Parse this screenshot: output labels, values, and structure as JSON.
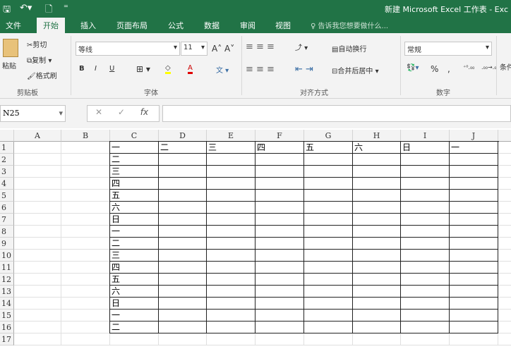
{
  "window": {
    "title": "新建 Microsoft Excel 工作表 - Exc"
  },
  "quick_access": {
    "save": "🖫",
    "undo": "↶▾",
    "new": "🗋",
    "more": "⁼"
  },
  "tabs": [
    {
      "label": "文件"
    },
    {
      "label": "开始",
      "active": true
    },
    {
      "label": "插入"
    },
    {
      "label": "页面布局"
    },
    {
      "label": "公式"
    },
    {
      "label": "数据"
    },
    {
      "label": "审阅"
    },
    {
      "label": "视图"
    }
  ],
  "tell_me": "告诉我您想要做什么...",
  "clipboard": {
    "paste": "粘贴",
    "cut": "剪切",
    "copy": "复制",
    "format_painter": "格式刷",
    "group": "剪贴板"
  },
  "font": {
    "name": "等线",
    "size": "11",
    "bold": "B",
    "italic": "I",
    "underline": "U",
    "group": "字体"
  },
  "alignment": {
    "wrap": "自动换行",
    "merge": "合并后居中",
    "group": "对齐方式"
  },
  "number": {
    "format": "常规",
    "percent": "%",
    "comma": ",",
    "inc": "⁺⁰.₀₀",
    "dec": ".₀₀→.₀",
    "group": "数字"
  },
  "styles": {
    "cond": "条件"
  },
  "formula_bar": {
    "name_box": "N25",
    "cancel": "✕",
    "enter": "✓",
    "fx": "fx",
    "value": ""
  },
  "sheet": {
    "columns": [
      "A",
      "B",
      "C",
      "D",
      "E",
      "F",
      "G",
      "H",
      "I",
      "J"
    ],
    "rows": [
      "1",
      "2",
      "3",
      "4",
      "5",
      "6",
      "7",
      "8",
      "9",
      "10",
      "11",
      "12",
      "13",
      "14",
      "15",
      "16",
      "17"
    ],
    "row1": [
      "",
      "",
      "一",
      "二",
      "三",
      "四",
      "五",
      "六",
      "日",
      "一"
    ],
    "colC": [
      "一",
      "二",
      "三",
      "四",
      "五",
      "六",
      "日",
      "一",
      "二",
      "三",
      "四",
      "五",
      "六",
      "日",
      "一",
      "二"
    ]
  }
}
